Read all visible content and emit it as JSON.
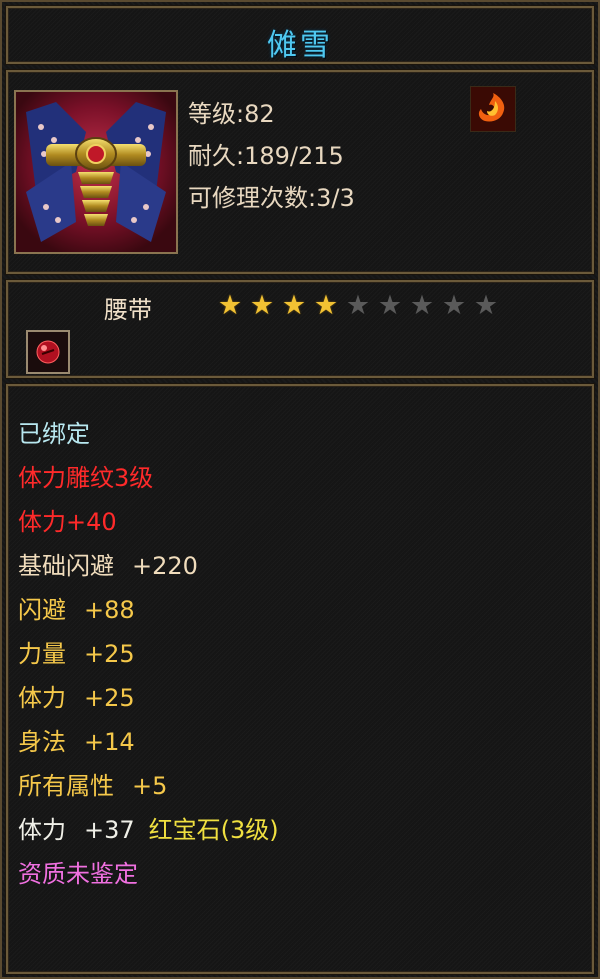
{
  "item": {
    "name": "傩雪",
    "type": "腰带",
    "level_label": "等级:82",
    "durability_label": "耐久:189/215",
    "repair_label": "可修理次数:3/3",
    "stars_total": 9,
    "stars_filled": 4
  },
  "attributes": {
    "bound": "已绑定",
    "engrave": "体力雕纹3级",
    "engrave_bonus": "体力+40",
    "base_dodge_name": "基础闪避",
    "base_dodge_val": "+220",
    "dodge_name": "闪避",
    "dodge_val": "+88",
    "str_name": "力量",
    "str_val": "+25",
    "vit_name": "体力",
    "vit_val": "+25",
    "agi_name": "身法",
    "agi_val": "+14",
    "all_name": "所有属性",
    "all_val": "+5",
    "gem_stat": "体力",
    "gem_val": "+37",
    "gem_name": "红宝石(3级)",
    "aptitude": "资质未鉴定"
  },
  "colors": {
    "title": "#4fc8f0",
    "engrave": "#ff2a2a",
    "yellow_stat": "#f5c84a",
    "aptitude": "#f070e0"
  }
}
